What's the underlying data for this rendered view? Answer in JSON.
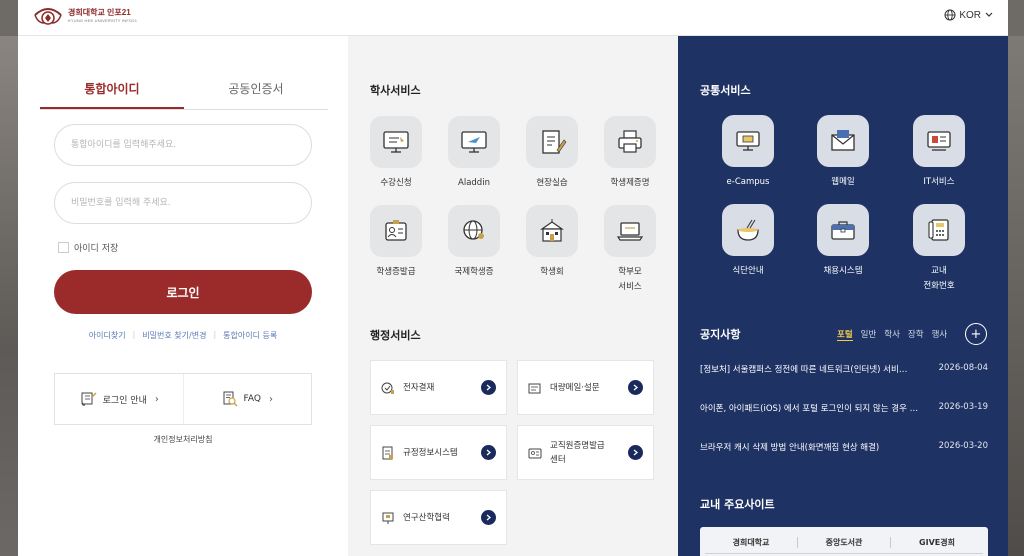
{
  "header": {
    "logo_title": "경희대학교 인포21",
    "logo_sub": "KYUNG HEE UNIVERSITY INFO21",
    "language": "KOR"
  },
  "login": {
    "tabs": [
      {
        "label": "통합아이디",
        "active": true
      },
      {
        "label": "공동인증서",
        "active": false
      }
    ],
    "id_placeholder": "통합아이디를 입력해주세요.",
    "pw_placeholder": "비밀번호를 입력해 주세요.",
    "save_id_label": "아이디 저장",
    "login_button": "로그인",
    "links": [
      "아이디찾기",
      "비밀번호 찾기/변경",
      "통합아이디 등록"
    ],
    "help": [
      {
        "label": "로그인 안내",
        "icon": "scroll-icon"
      },
      {
        "label": "FAQ",
        "icon": "document-search-icon"
      }
    ],
    "privacy": "개인정보처리방침"
  },
  "academic": {
    "title": "학사서비스",
    "items": [
      {
        "label": "수강신청",
        "icon": "monitor-register-icon"
      },
      {
        "label": "Aladdin",
        "icon": "monitor-plane-icon"
      },
      {
        "label": "현장실습",
        "icon": "notebook-pen-icon"
      },
      {
        "label": "학생제증명",
        "icon": "printer-icon"
      },
      {
        "label": "학생증발급",
        "icon": "id-card-icon"
      },
      {
        "label": "국제학생증",
        "icon": "globe-person-icon"
      },
      {
        "label": "학생회",
        "icon": "building-icon"
      },
      {
        "label": "학부모\n서비스",
        "icon": "laptop-icon"
      }
    ]
  },
  "admin": {
    "title": "행정서비스",
    "items": [
      {
        "label": "전자결재",
        "icon": "approval-icon"
      },
      {
        "label": "대량메일·설문",
        "icon": "mail-survey-icon"
      },
      {
        "label": "규정정보시스템",
        "icon": "rules-document-icon"
      },
      {
        "label": "교직원증명발급\n센터",
        "icon": "staff-card-icon"
      },
      {
        "label": "연구산학협력",
        "icon": "research-icon"
      }
    ]
  },
  "common": {
    "title": "공통서비스",
    "items": [
      {
        "label": "e-Campus",
        "icon": "ecampus-icon"
      },
      {
        "label": "웹메일",
        "icon": "webmail-icon"
      },
      {
        "label": "IT서비스",
        "icon": "it-service-icon"
      },
      {
        "label": "식단안내",
        "icon": "meal-bowl-icon"
      },
      {
        "label": "채용시스템",
        "icon": "briefcase-icon"
      },
      {
        "label": "교내\n전화번호",
        "icon": "phone-icon"
      }
    ]
  },
  "notices": {
    "title": "공지사항",
    "tabs": [
      {
        "label": "포털",
        "active": true
      },
      {
        "label": "일반",
        "active": false
      },
      {
        "label": "학사",
        "active": false
      },
      {
        "label": "장학",
        "active": false
      },
      {
        "label": "행사",
        "active": false
      }
    ],
    "more_label": "+",
    "items": [
      {
        "title": "[정보처] 서울캠퍼스 정전에 따른 네트워크(인터넷) 서비…",
        "date": "2026-08-04"
      },
      {
        "title": "아이폰, 아이패드(iOS) 에서 포털 로그인이 되지 않는 경우 …",
        "date": "2026-03-19"
      },
      {
        "title": "브라우저 캐시 삭제 방법 안내(화면깨짐 현상 해결)",
        "date": "2026-03-20"
      }
    ]
  },
  "sites": {
    "title": "교내 주요사이트",
    "items": [
      "경희대학교",
      "중앙도서관",
      "GIVE경희"
    ]
  },
  "colors": {
    "brand_red": "#9b2b2b",
    "navy": "#1e3264",
    "notice_active": "#f3c94a"
  }
}
